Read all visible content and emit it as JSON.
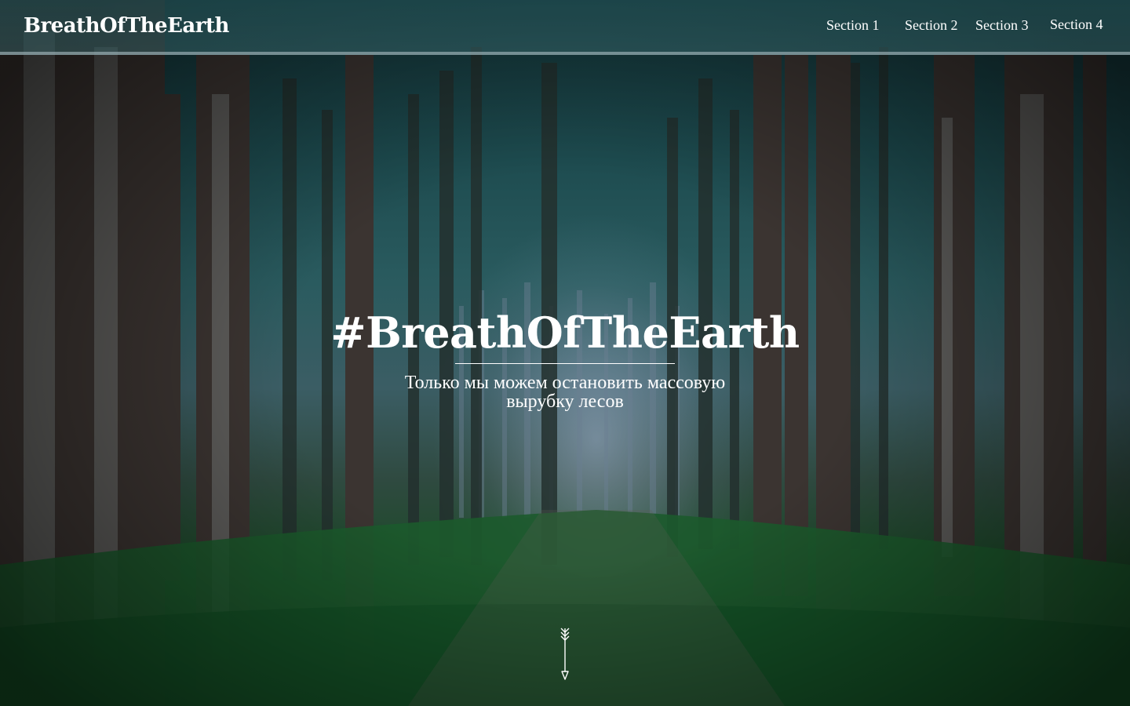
{
  "header": {
    "logo": "BreathOfTheEarth",
    "nav": [
      {
        "label": "Section 1"
      },
      {
        "label": "Section 2"
      },
      {
        "label": "Section 3"
      },
      {
        "label": "Section 4"
      }
    ]
  },
  "hero": {
    "title": "#BreathOfTheEarth",
    "subtitle": "Только мы можем остановить массовую вырубку лесов",
    "scroll_icon": "arrow-down-icon",
    "background": "misty-forest-photo"
  },
  "colors": {
    "text": "#ffffff",
    "header_bg": "#2f6a70",
    "forest_green": "#1f4a2c",
    "mist": "#aab9d7"
  }
}
